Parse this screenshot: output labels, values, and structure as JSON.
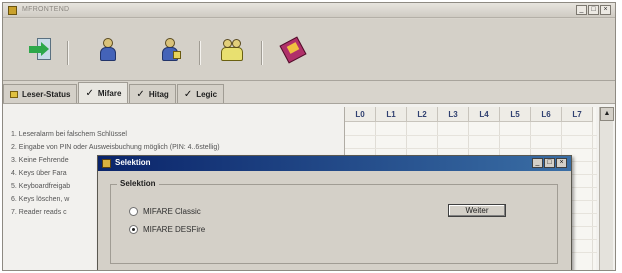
{
  "window": {
    "title": "MFRONTEND",
    "controls": [
      "_",
      "□",
      "×"
    ]
  },
  "toolbar": {
    "buttons": [
      {
        "name": "exit-door-icon"
      },
      {
        "name": "user-icon"
      },
      {
        "name": "user-badge-icon"
      },
      {
        "name": "group-icon"
      },
      {
        "name": "book-icon"
      }
    ]
  },
  "tabs": [
    {
      "label": "Leser-Status",
      "checked": false,
      "icon": "status-icon"
    },
    {
      "label": "Mifare",
      "checked": true
    },
    {
      "label": "Hitag",
      "checked": true
    },
    {
      "label": "Legic",
      "checked": true
    }
  ],
  "list": {
    "items": [
      "1. Leseralarm bei falschem Schlüssel",
      "2. Eingabe von PIN oder Ausweisbuchung möglich (PIN: 4..6stellig)",
      "3. Keine Fehrende",
      "4. Keys über Fara",
      "5. Keyboardfreigab",
      "6. Keys löschen, w",
      "7. Reader reads c"
    ]
  },
  "grid": {
    "columns": [
      "L0",
      "L1",
      "L2",
      "L3",
      "L4",
      "L5",
      "L6",
      "L7"
    ]
  },
  "scrollbar": {
    "up_arrow": "▲"
  },
  "dialog": {
    "title": "Selektion",
    "controls": [
      "_",
      "□",
      "×"
    ],
    "group_label": "Selektion",
    "options": [
      {
        "label": "MIFARE Classic",
        "selected": false
      },
      {
        "label": "MIFARE DESFire",
        "selected": true
      }
    ],
    "button_label": "Weiter"
  }
}
